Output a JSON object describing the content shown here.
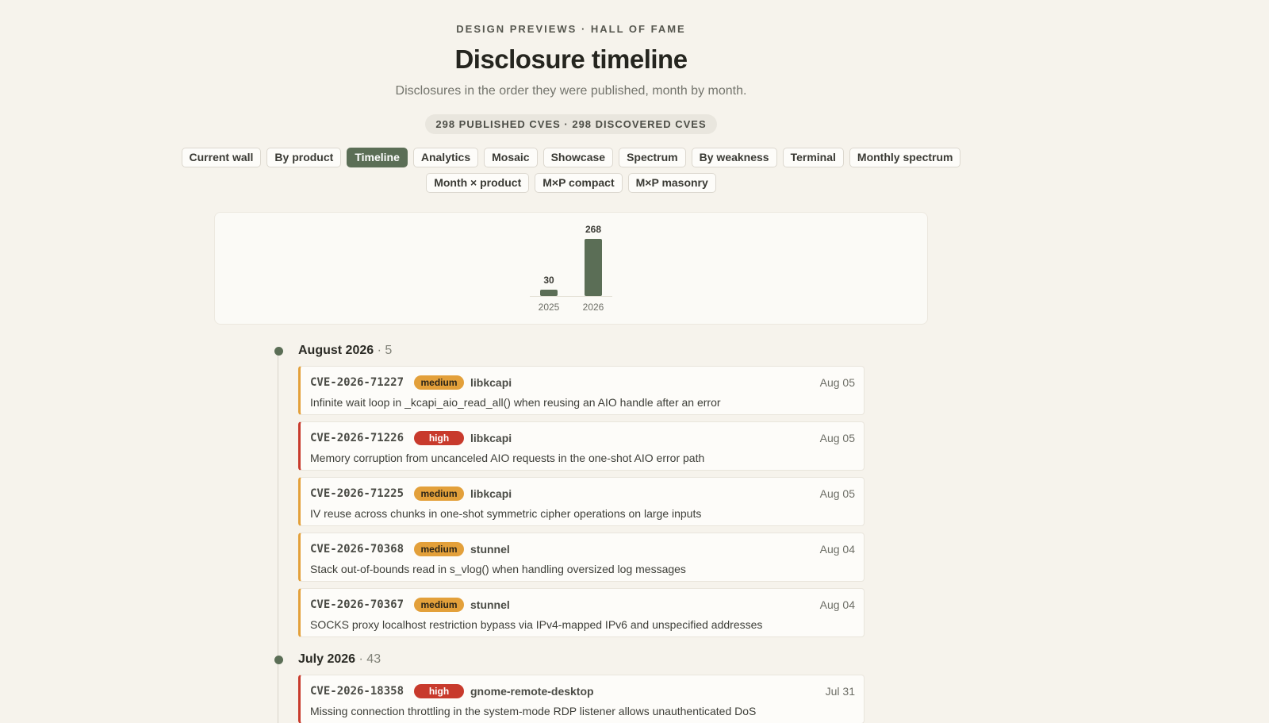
{
  "header": {
    "eyebrow": "DESIGN PREVIEWS · HALL OF FAME",
    "title": "Disclosure timeline",
    "subtitle": "Disclosures in the order they were published, month by month.",
    "stats": "298 PUBLISHED CVES · 298 DISCOVERED CVES"
  },
  "tabs": [
    {
      "label": "Current wall",
      "active": false
    },
    {
      "label": "By product",
      "active": false
    },
    {
      "label": "Timeline",
      "active": true
    },
    {
      "label": "Analytics",
      "active": false
    },
    {
      "label": "Mosaic",
      "active": false
    },
    {
      "label": "Showcase",
      "active": false
    },
    {
      "label": "Spectrum",
      "active": false
    },
    {
      "label": "By weakness",
      "active": false
    },
    {
      "label": "Terminal",
      "active": false
    },
    {
      "label": "Monthly spectrum",
      "active": false
    },
    {
      "label": "Month × product",
      "active": false
    },
    {
      "label": "M×P compact",
      "active": false
    },
    {
      "label": "M×P masonry",
      "active": false
    }
  ],
  "colors": {
    "accent": "#5b6e56",
    "medium": "#e3a03a",
    "high": "#c83a2c",
    "background": "#f6f3ec"
  },
  "chart_data": {
    "type": "bar",
    "categories": [
      "2025",
      "2026"
    ],
    "values": [
      30,
      268
    ],
    "title": "",
    "xlabel": "",
    "ylabel": "",
    "ylim": [
      0,
      268
    ],
    "grid": false
  },
  "months": [
    {
      "name": "August 2026",
      "count": "· 5",
      "entries": [
        {
          "id": "CVE-2026-71227",
          "severity": "medium",
          "product": "libkcapi",
          "date": "Aug 05",
          "desc": "Infinite wait loop in _kcapi_aio_read_all() when reusing an AIO handle after an error"
        },
        {
          "id": "CVE-2026-71226",
          "severity": "high",
          "product": "libkcapi",
          "date": "Aug 05",
          "desc": "Memory corruption from uncanceled AIO requests in the one-shot AIO error path"
        },
        {
          "id": "CVE-2026-71225",
          "severity": "medium",
          "product": "libkcapi",
          "date": "Aug 05",
          "desc": "IV reuse across chunks in one-shot symmetric cipher operations on large inputs"
        },
        {
          "id": "CVE-2026-70368",
          "severity": "medium",
          "product": "stunnel",
          "date": "Aug 04",
          "desc": "Stack out-of-bounds read in s_vlog() when handling oversized log messages"
        },
        {
          "id": "CVE-2026-70367",
          "severity": "medium",
          "product": "stunnel",
          "date": "Aug 04",
          "desc": "SOCKS proxy localhost restriction bypass via IPv4-mapped IPv6 and unspecified addresses"
        }
      ]
    },
    {
      "name": "July 2026",
      "count": "· 43",
      "entries": [
        {
          "id": "CVE-2026-18358",
          "severity": "high",
          "product": "gnome-remote-desktop",
          "date": "Jul 31",
          "desc": "Missing connection throttling in the system-mode RDP listener allows unauthenticated DoS"
        }
      ]
    }
  ]
}
